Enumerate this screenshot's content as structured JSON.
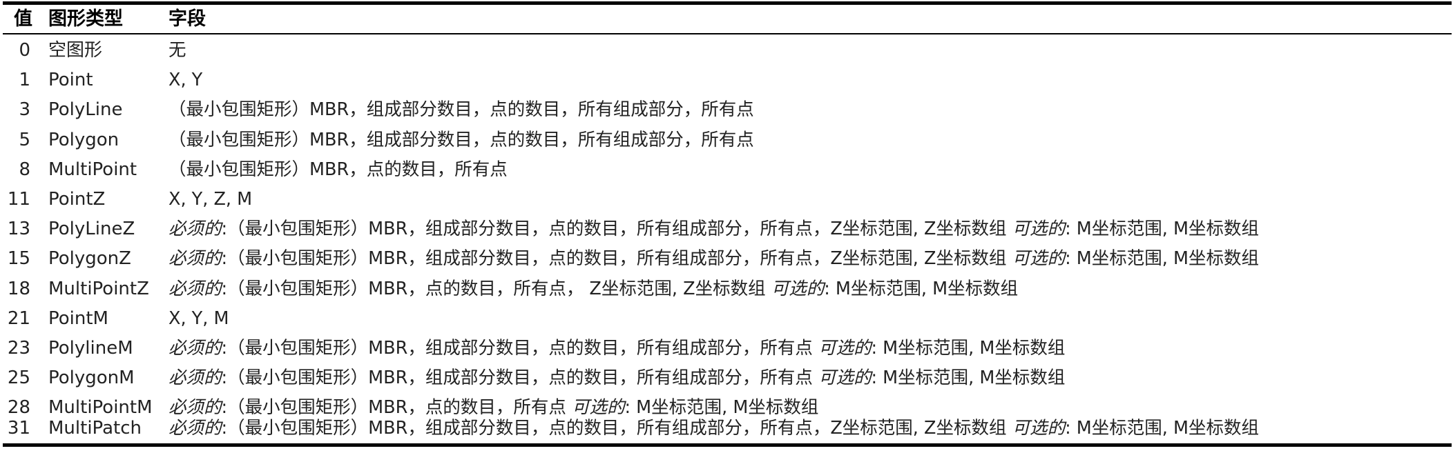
{
  "header": {
    "value": "值",
    "type": "图形类型",
    "fields": "字段"
  },
  "rows": [
    {
      "value": "0",
      "type": "空图形",
      "req": "",
      "fields": "无",
      "opt": "",
      "opt_fields": ""
    },
    {
      "value": "1",
      "type": "Point",
      "req": "",
      "fields": "X, Y",
      "opt": "",
      "opt_fields": ""
    },
    {
      "value": "3",
      "type": "PolyLine",
      "req": "",
      "fields": "（最小包围矩形）MBR，组成部分数目，点的数目，所有组成部分，所有点",
      "opt": "",
      "opt_fields": ""
    },
    {
      "value": "5",
      "type": "Polygon",
      "req": "",
      "fields": "（最小包围矩形）MBR，组成部分数目，点的数目，所有组成部分，所有点",
      "opt": "",
      "opt_fields": ""
    },
    {
      "value": "8",
      "type": "MultiPoint",
      "req": "",
      "fields": "（最小包围矩形）MBR，点的数目，所有点",
      "opt": "",
      "opt_fields": ""
    },
    {
      "value": "11",
      "type": "PointZ",
      "req": "",
      "fields": "X, Y, Z, M",
      "opt": "",
      "opt_fields": ""
    },
    {
      "value": "13",
      "type": "PolyLineZ",
      "req": "必须的",
      "fields": ":（最小包围矩形）MBR，组成部分数目，点的数目，所有组成部分，所有点，Z坐标范围, Z坐标数组 ",
      "opt": "可选的",
      "opt_fields": ": M坐标范围, M坐标数组"
    },
    {
      "value": "15",
      "type": "PolygonZ",
      "req": "必须的",
      "fields": ":（最小包围矩形）MBR，组成部分数目，点的数目，所有组成部分，所有点，Z坐标范围, Z坐标数组 ",
      "opt": "可选的",
      "opt_fields": ": M坐标范围, M坐标数组"
    },
    {
      "value": "18",
      "type": "MultiPointZ",
      "req": "必须的",
      "fields": ":（最小包围矩形）MBR，点的数目，所有点， Z坐标范围, Z坐标数组 ",
      "opt": "可选的",
      "opt_fields": ": M坐标范围, M坐标数组"
    },
    {
      "value": "21",
      "type": "PointM",
      "req": "",
      "fields": "X, Y, M",
      "opt": "",
      "opt_fields": ""
    },
    {
      "value": "23",
      "type": "PolylineM",
      "req": "必须的",
      "fields": ":（最小包围矩形）MBR，组成部分数目，点的数目，所有组成部分，所有点 ",
      "opt": "可选的",
      "opt_fields": ": M坐标范围, M坐标数组"
    },
    {
      "value": "25",
      "type": "PolygonM",
      "req": "必须的",
      "fields": ":（最小包围矩形）MBR，组成部分数目，点的数目，所有组成部分，所有点 ",
      "opt": "可选的",
      "opt_fields": ": M坐标范围, M坐标数组"
    },
    {
      "value": "28",
      "type": "MultiPointM",
      "req": "必须的",
      "fields": ":（最小包围矩形）MBR，点的数目，所有点 ",
      "opt": "可选的",
      "opt_fields": ": M坐标范围, M坐标数组"
    },
    {
      "value": "31",
      "type": "MultiPatch",
      "req": "必须的",
      "fields": ":（最小包围矩形）MBR，组成部分数目，点的数目，所有组成部分，所有点，Z坐标范围, Z坐标数组 ",
      "opt": "可选的",
      "opt_fields": ": M坐标范围, M坐标数组"
    }
  ]
}
